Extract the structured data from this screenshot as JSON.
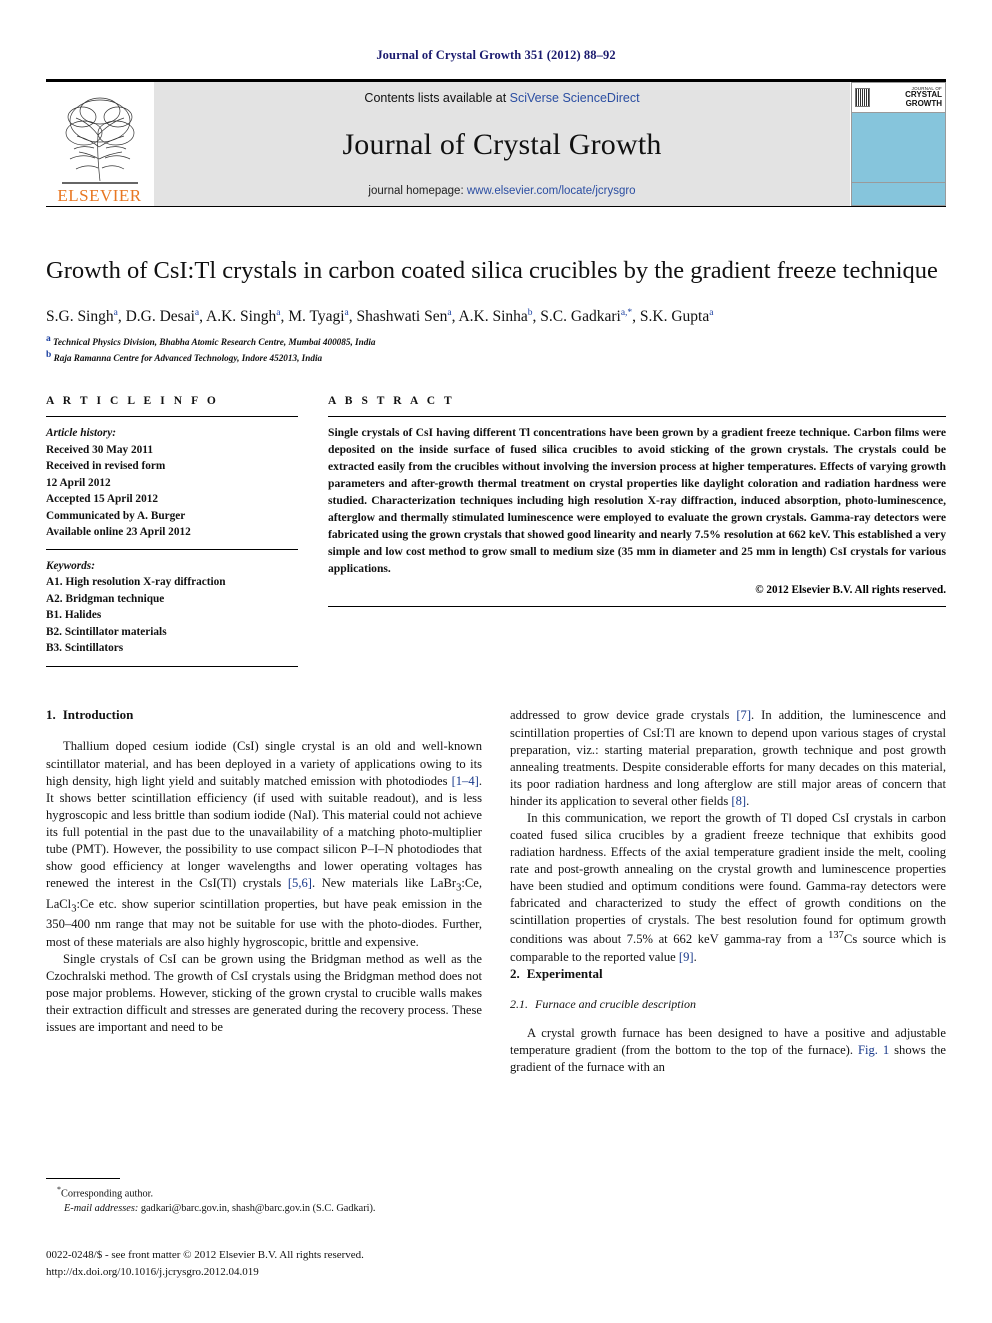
{
  "running_head": "Journal of Crystal Growth 351 (2012) 88–92",
  "masthead": {
    "publisher_name": "ELSEVIER",
    "contents_prefix": "Contents lists available at ",
    "contents_link": "SciVerse ScienceDirect",
    "journal_name": "Journal of Crystal Growth",
    "homepage_prefix": "journal homepage: ",
    "homepage_url": "www.elsevier.com/locate/jcrysgro",
    "cover_pre": "JOURNAL OF",
    "cover_title_1": "CRYSTAL",
    "cover_title_2": "GROWTH"
  },
  "article": {
    "title": "Growth of CsI:Tl crystals in carbon coated silica crucibles by the gradient freeze technique",
    "authors": [
      {
        "name": "S.G. Singh",
        "sup": "a"
      },
      {
        "name": "D.G. Desai",
        "sup": "a"
      },
      {
        "name": "A.K. Singh",
        "sup": "a"
      },
      {
        "name": "M. Tyagi",
        "sup": "a"
      },
      {
        "name": "Shashwati Sen",
        "sup": "a"
      },
      {
        "name": "A.K. Sinha",
        "sup": "b"
      },
      {
        "name": "S.C. Gadkari",
        "sup": "a,*"
      },
      {
        "name": "S.K. Gupta",
        "sup": "a"
      }
    ],
    "affiliations": [
      {
        "sup": "a",
        "text": "Technical Physics Division, Bhabha Atomic Research Centre, Mumbai 400085, India"
      },
      {
        "sup": "b",
        "text": "Raja Ramanna Centre for Advanced Technology, Indore 452013, India"
      }
    ]
  },
  "article_info": {
    "heading": "A R T I C L E  I N F O",
    "history_label": "Article history:",
    "history": [
      "Received 30 May 2011",
      "Received in revised form",
      "12 April 2012",
      "Accepted 15 April 2012",
      "Communicated by A. Burger",
      "Available online 23 April 2012"
    ],
    "keywords_label": "Keywords:",
    "keywords": [
      "A1. High resolution X-ray diffraction",
      "A2. Bridgman technique",
      "B1. Halides",
      "B2. Scintillator materials",
      "B3. Scintillators"
    ]
  },
  "abstract": {
    "heading": "A B S T R A C T",
    "text": "Single crystals of CsI having different Tl concentrations have been grown by a gradient freeze technique. Carbon films were deposited on the inside surface of fused silica crucibles to avoid sticking of the grown crystals. The crystals could be extracted easily from the crucibles without involving the inversion process at higher temperatures. Effects of varying growth parameters and after-growth thermal treatment on crystal properties like daylight coloration and radiation hardness were studied. Characterization techniques including high resolution X-ray diffraction, induced absorption, photo-luminescence, afterglow and thermally stimulated luminescence were employed to evaluate the grown crystals. Gamma-ray detectors were fabricated using the grown crystals that showed good linearity and nearly 7.5% resolution at 662 keV. This established a very simple and low cost method to grow small to medium size (35 mm in diameter and 25 mm in length) CsI crystals for various applications.",
    "copyright": "© 2012 Elsevier B.V. All rights reserved."
  },
  "sections": {
    "introduction": {
      "number": "1.",
      "title": "Introduction",
      "p1_a": "Thallium doped cesium iodide (CsI) single crystal is an old and well-known scintillator material, and has been deployed in a variety of applications owing to its high density, high light yield and suitably matched emission with photodiodes ",
      "p1_ref1": "[1–4]",
      "p1_b": ". It shows better scintillation efficiency (if used with suitable readout), and is less hygroscopic and less brittle than sodium iodide (NaI). This material could not achieve its full potential in the past due to the unavailability of a matching photo-multiplier tube (PMT). However, the possibility to use compact silicon P–I–N photodiodes that show good efficiency at longer wavelengths and lower operating voltages has renewed the interest in the CsI(Tl) crystals ",
      "p1_ref2": "[5,6]",
      "p1_c": ". New materials like LaBr3:Ce, LaCl3:Ce etc. show superior scintillation properties, but have peak emission in the 350–400 nm range that may not be suitable for use with the photo-diodes. Further, most of these materials are also highly hygroscopic, brittle and expensive.",
      "p2": "Single crystals of CsI can be grown using the Bridgman method as well as the Czochralski method. The growth of CsI crystals using the Bridgman method does not pose major problems. However, sticking of the grown crystal to crucible walls makes their extraction difficult and stresses are generated during the recovery process. These issues are important and need to be",
      "p3_a": "addressed to grow device grade crystals ",
      "p3_ref1": "[7]",
      "p3_b": ". In addition, the luminescence and scintillation properties of CsI:Tl are known to depend upon various stages of crystal preparation, viz.: starting material preparation, growth technique and post growth annealing treatments. Despite considerable efforts for many decades on this material, its poor radiation hardness and long afterglow are still major areas of concern that hinder its application to several other fields ",
      "p3_ref2": "[8]",
      "p3_c": ".",
      "p4_a": "In this communication, we report the growth of Tl doped CsI crystals in carbon coated fused silica crucibles by a gradient freeze technique that exhibits good radiation hardness. Effects of the axial temperature gradient inside the melt, cooling rate and post-growth annealing on the crystal growth and luminescence properties have been studied and optimum conditions were found. Gamma-ray detectors were fabricated and characterized to study the effect of growth conditions on the scintillation properties of crystals. The best resolution found for optimum growth conditions was about 7.5% at 662 keV gamma-ray from a ",
      "p4_sup": "137",
      "p4_b": "Cs source which is comparable to the reported value ",
      "p4_ref": "[9]",
      "p4_c": "."
    },
    "experimental": {
      "number": "2.",
      "title": "Experimental",
      "sub_number": "2.1.",
      "sub_title": "Furnace and crucible description",
      "p1_a": "A crystal growth furnace has been designed to have a positive and adjustable temperature gradient (from the bottom to the top of the furnace). ",
      "p1_ref": "Fig. 1",
      "p1_b": " shows the gradient of the furnace with an"
    }
  },
  "footnote": {
    "star": "*",
    "corresponding": "Corresponding author.",
    "email_label": "E-mail addresses:",
    "emails": "gadkari@barc.gov.in, shash@barc.gov.in (S.C. Gadkari)."
  },
  "footer": {
    "issn_line": "0022-0248/$ - see front matter © 2012 Elsevier B.V. All rights reserved.",
    "doi_line": "http://dx.doi.org/10.1016/j.jcrysgro.2012.04.019"
  }
}
